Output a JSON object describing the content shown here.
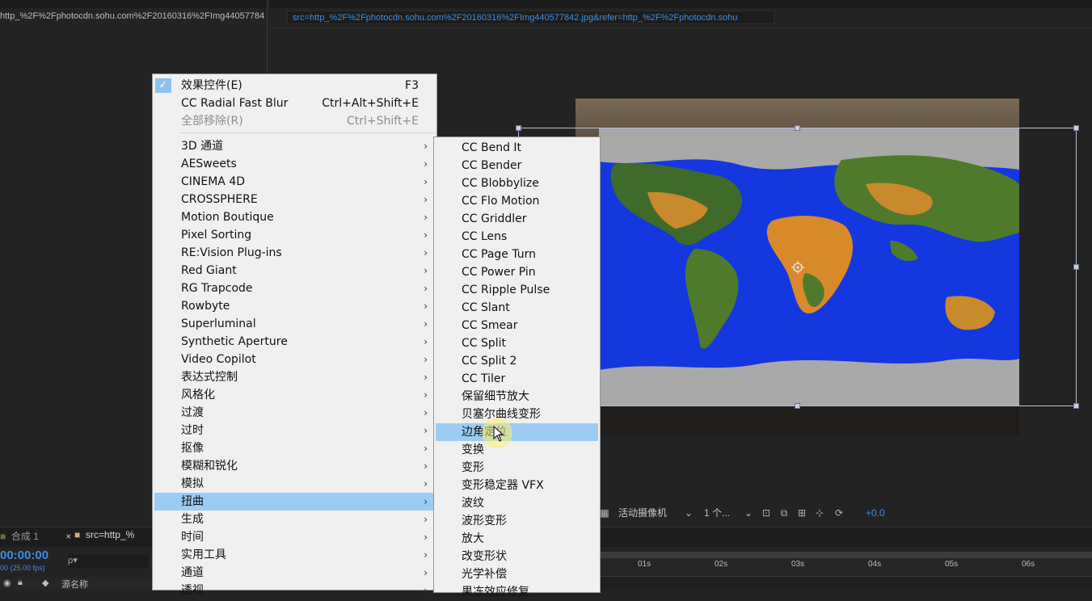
{
  "left_panel": {
    "path": "http_%2F%2Fphotocdn.sohu.com%2F20160316%2FImg44057784"
  },
  "comp_viewer": {
    "src_field": "src=http_%2F%2Fphotocdn.sohu.com%2F20160316%2FImg440577842.jpg&refer=http_%2F%2Fphotocdn.sohu",
    "camera_select": "活动摄像机",
    "view_select": "1 个...",
    "exposure": "+0.0"
  },
  "timeline": {
    "tab_comp": "合成 1",
    "tab_src": "src=http_%",
    "timecode": "00:00:00",
    "fps": "00 (25.00 fps)",
    "search_icon_label": "ρ▾",
    "col_source_name": "源名称",
    "ticks": [
      "01s",
      "02s",
      "03s",
      "04s",
      "05s",
      "06s"
    ]
  },
  "menu": {
    "top_items": [
      {
        "label": "效果控件(E)",
        "shortcut": "F3",
        "checked": true,
        "disabled": false
      },
      {
        "label": "CC Radial Fast Blur",
        "shortcut": "Ctrl+Alt+Shift+E",
        "checked": false,
        "disabled": false
      },
      {
        "label": "全部移除(R)",
        "shortcut": "Ctrl+Shift+E",
        "checked": false,
        "disabled": true
      }
    ],
    "categories": [
      "3D 通道",
      "AESweets",
      "CINEMA 4D",
      "CROSSPHERE",
      "Motion Boutique",
      "Pixel Sorting",
      "RE:Vision Plug-ins",
      "Red Giant",
      "RG Trapcode",
      "Rowbyte",
      "Superluminal",
      "Synthetic Aperture",
      "Video Copilot",
      "表达式控制",
      "风格化",
      "过渡",
      "过时",
      "抠像",
      "模糊和锐化",
      "模拟",
      "扭曲",
      "生成",
      "时间",
      "实用工具",
      "通道",
      "透视"
    ],
    "highlighted_category": "扭曲"
  },
  "submenu": {
    "items": [
      "CC Bend It",
      "CC Bender",
      "CC Blobbylize",
      "CC Flo Motion",
      "CC Griddler",
      "CC Lens",
      "CC Page Turn",
      "CC Power Pin",
      "CC Ripple Pulse",
      "CC Slant",
      "CC Smear",
      "CC Split",
      "CC Split 2",
      "CC Tiler",
      "保留细节放大",
      "贝塞尔曲线变形",
      "边角定位",
      "变换",
      "变形",
      "变形稳定器 VFX",
      "波纹",
      "波形变形",
      "放大",
      "改变形状",
      "光学补偿",
      "果冻效应修复"
    ],
    "highlighted": "边角定位"
  },
  "colors": {
    "menu_highlight": "#9ccbf3",
    "accent_blue": "#3d8fe8",
    "ocean": "#1437e0"
  }
}
